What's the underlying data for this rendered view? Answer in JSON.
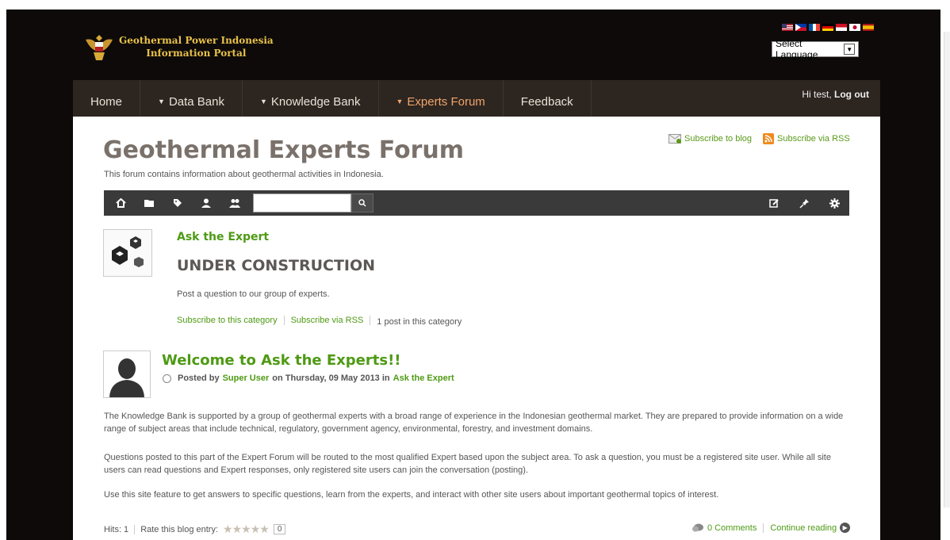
{
  "header": {
    "logo_line1": "Geothermal Power Indonesia",
    "logo_line2": "Information Portal",
    "language_select": "Select Language"
  },
  "nav": {
    "items": [
      {
        "label": "Home",
        "dropdown": false
      },
      {
        "label": "Data Bank",
        "dropdown": true
      },
      {
        "label": "Knowledge Bank",
        "dropdown": true
      },
      {
        "label": "Experts Forum",
        "dropdown": true,
        "active": true
      },
      {
        "label": "Feedback",
        "dropdown": false
      }
    ],
    "greeting": "Hi test,",
    "logout": "Log out"
  },
  "subscribe": {
    "blog": "Subscribe to blog",
    "rss": "Subscribe via RSS"
  },
  "forum": {
    "title": "Geothermal Experts Forum",
    "description": "This forum contains information about geothermal activities in Indonesia."
  },
  "toolbar": {
    "search_placeholder": "",
    "left_icons": [
      "home-icon",
      "folder-icon",
      "tag-icon",
      "user-icon",
      "users-icon"
    ],
    "right_icons": [
      "edit-icon",
      "pin-icon",
      "gear-icon"
    ]
  },
  "category": {
    "name": "Ask the Expert",
    "heading": "UNDER CONSTRUCTION",
    "description": "Post a question to our group of experts.",
    "subscribe_category": "Subscribe to this category",
    "subscribe_rss": "Subscribe via RSS",
    "post_count": "1 post in this category"
  },
  "post": {
    "title": "Welcome to Ask the Experts!!",
    "posted_by": "Posted by",
    "author": "Super User",
    "date": "on Thursday, 09 May 2013 in",
    "category": "Ask the Expert",
    "paragraphs": [
      "The Knowledge Bank is supported by a group of geothermal experts with a broad range of experience in the Indonesian geothermal market.  They are prepared to provide information on a wide range of subject areas that include technical, regulatory, government agency, environmental, forestry, and investment domains.",
      "Questions posted to this part of the Expert Forum will be routed to the most qualified Expert based upon the subject area.  To ask a question, you must be a registered site user. While all site users can read questions and  Expert responses, only registered site users can join the conversation (posting).",
      "Use this site feature to get answers to specific questions, learn from the experts, and interact with other site users about important geothermal topics of interest."
    ],
    "hits": "Hits: 1",
    "rate_label": "Rate this blog entry:",
    "rating": "0",
    "rating_value": 0,
    "comments": "0 Comments",
    "continue": "Continue reading"
  },
  "colors": {
    "accent_green": "#4e9a14",
    "nav_bg": "#2d2520",
    "nav_active": "#f0a56a",
    "page_bg": "#0d0a09"
  }
}
